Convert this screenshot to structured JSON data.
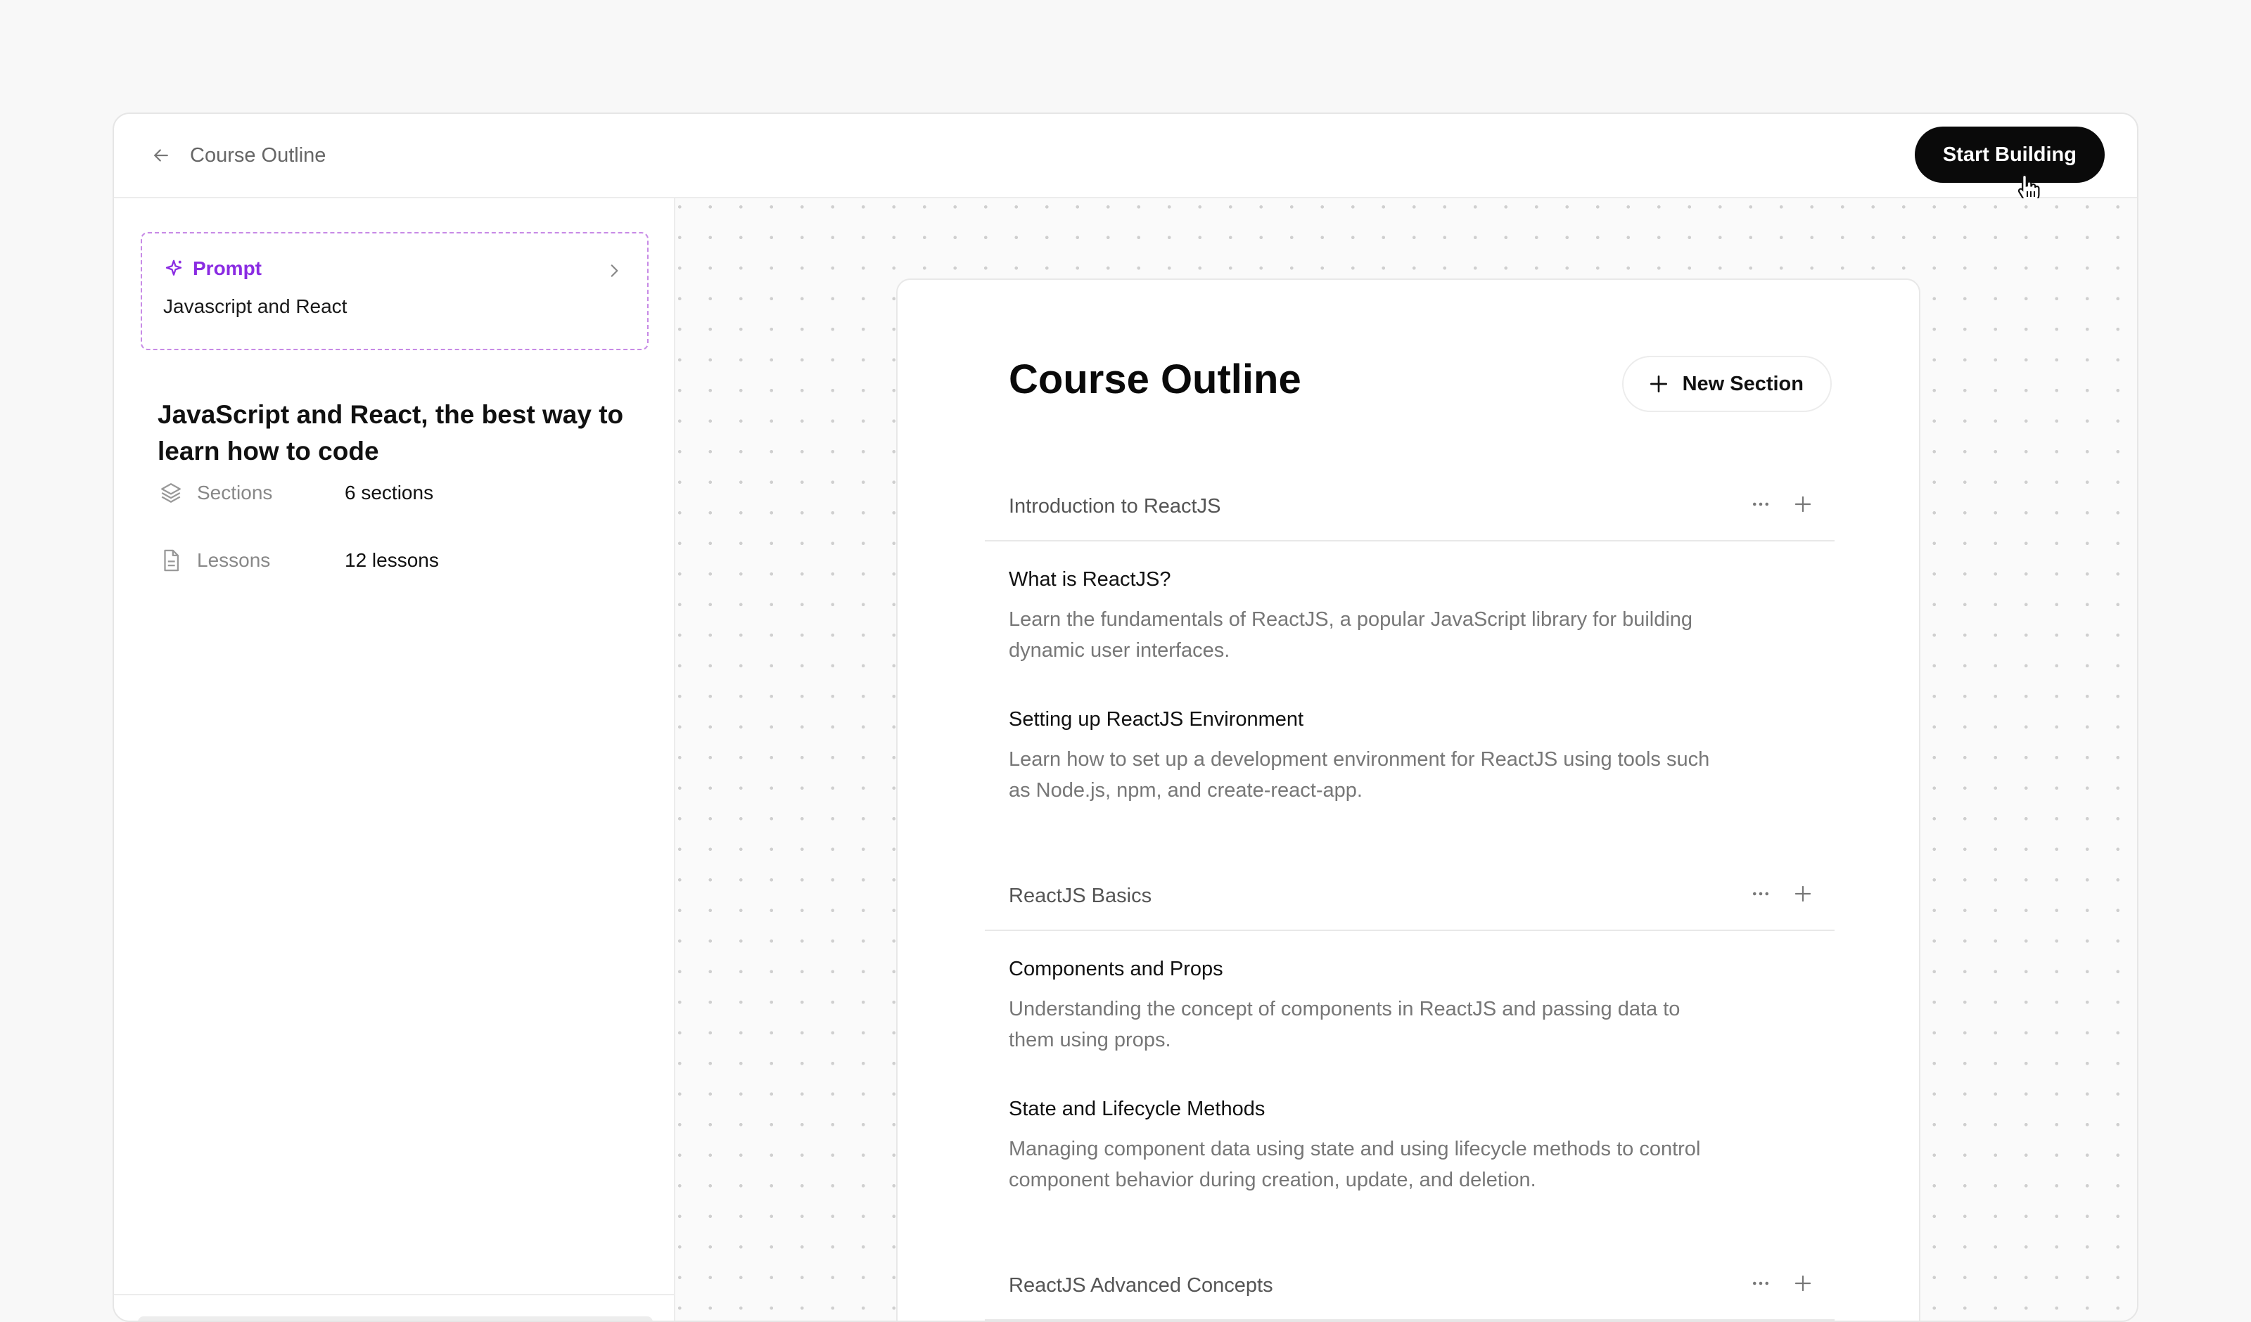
{
  "topbar": {
    "back_label": "Course Outline",
    "start_button": "Start Building"
  },
  "sidebar": {
    "prompt": {
      "label": "Prompt",
      "text": "Javascript and React"
    },
    "course_title": "JavaScript and React, the best way to learn how to code",
    "stats": [
      {
        "icon": "layers-icon",
        "label": "Sections",
        "value": "6 sections"
      },
      {
        "icon": "document-icon",
        "label": "Lessons",
        "value": "12 lessons"
      }
    ]
  },
  "outline": {
    "title": "Course Outline",
    "new_section_button": "New Section",
    "sections": [
      {
        "title": "Introduction to ReactJS",
        "lessons": [
          {
            "title": "What is ReactJS?",
            "description": "Learn the fundamentals of ReactJS, a popular JavaScript library for building dynamic user interfaces."
          },
          {
            "title": "Setting up ReactJS Environment",
            "description": "Learn how to set up a development environment for ReactJS using tools such as Node.js, npm, and create-react-app."
          }
        ]
      },
      {
        "title": "ReactJS Basics",
        "lessons": [
          {
            "title": "Components and Props",
            "description": "Understanding the concept of components in ReactJS and passing data to them using props."
          },
          {
            "title": "State and Lifecycle Methods",
            "description": "Managing component data using state and using lifecycle methods to control component behavior during creation, update, and deletion."
          }
        ]
      },
      {
        "title": "ReactJS Advanced Concepts",
        "lessons": []
      }
    ]
  },
  "colors": {
    "accent": "#8a2be2",
    "primary_button": "#0a0a0a"
  }
}
